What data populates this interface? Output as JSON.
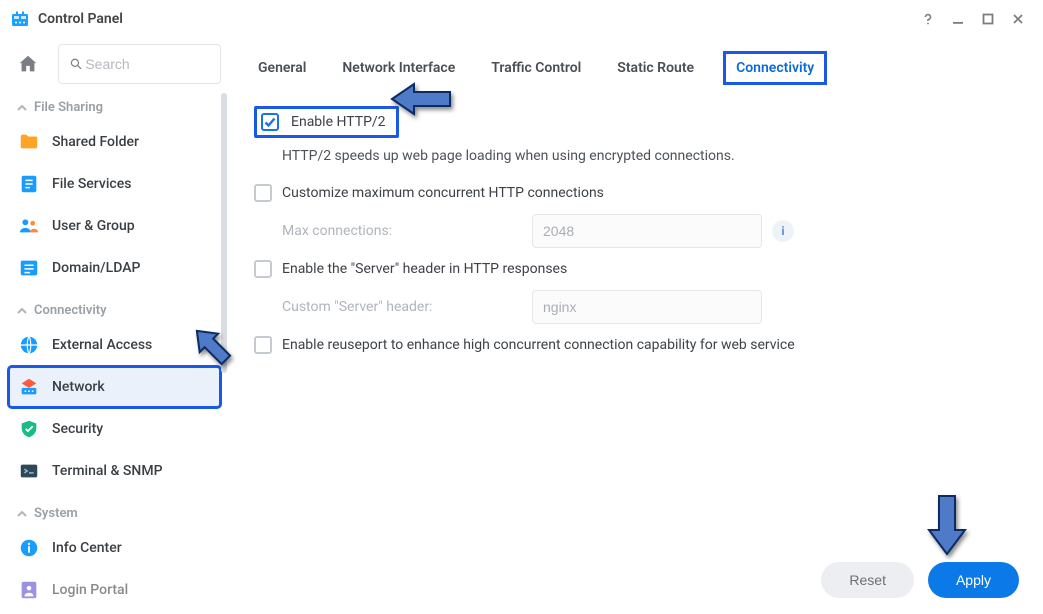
{
  "window": {
    "title": "Control Panel"
  },
  "search": {
    "placeholder": "Search"
  },
  "sections": {
    "file_sharing": {
      "header": "File Sharing",
      "items": [
        "Shared Folder",
        "File Services",
        "User & Group",
        "Domain/LDAP"
      ]
    },
    "connectivity": {
      "header": "Connectivity",
      "items": [
        "External Access",
        "Network",
        "Security",
        "Terminal & SNMP"
      ]
    },
    "system": {
      "header": "System",
      "items": [
        "Info Center",
        "Login Portal"
      ]
    }
  },
  "tabs": [
    "General",
    "Network Interface",
    "Traffic Control",
    "Static Route",
    "Connectivity"
  ],
  "settings": {
    "enable_http2": {
      "label": "Enable HTTP/2",
      "checked": true,
      "desc": "HTTP/2 speeds up web page loading when using encrypted connections."
    },
    "customize_max": {
      "label": "Customize maximum concurrent HTTP connections",
      "checked": false,
      "field_label": "Max connections:",
      "value": "2048"
    },
    "server_header": {
      "label": "Enable the \"Server\" header in HTTP responses",
      "checked": false,
      "field_label": "Custom \"Server\" header:",
      "value": "nginx"
    },
    "reuseport": {
      "label": "Enable reuseport to enhance high concurrent connection capability for web service",
      "checked": false
    }
  },
  "buttons": {
    "reset": "Reset",
    "apply": "Apply"
  },
  "info_tooltip_glyph": "i"
}
